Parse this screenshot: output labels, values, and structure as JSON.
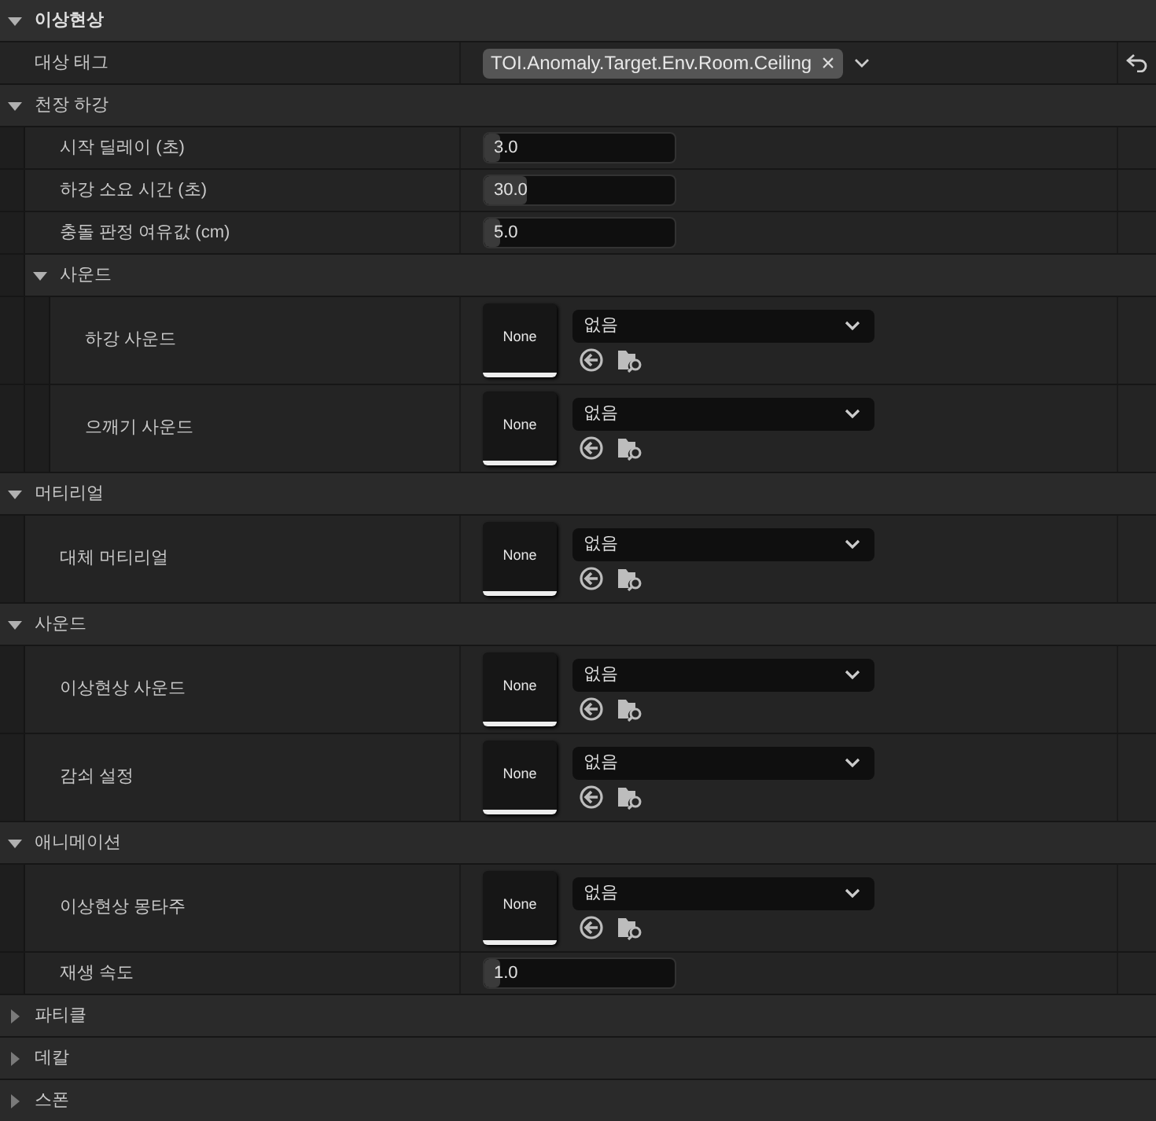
{
  "category": {
    "label": "이상현상",
    "expanded": true,
    "children": [
      {
        "kind": "tag",
        "name": "대상 태그",
        "tag": "TOI.Anomaly.Target.Env.Room.Ceiling",
        "remove_glyph": "×",
        "modified": true
      },
      {
        "kind": "group",
        "label": "천장 하강",
        "expanded": true,
        "children": [
          {
            "kind": "number",
            "name": "시작 딜레이 (초)",
            "value": "3.0",
            "level": 0.08
          },
          {
            "kind": "number",
            "name": "하강 소요 시간 (초)",
            "value": "30.0",
            "level": 0.22
          },
          {
            "kind": "number",
            "name": "충돌 판정 여유값 (cm)",
            "value": "5.0",
            "level": 0.08
          },
          {
            "kind": "group",
            "label": "사운드",
            "expanded": true,
            "children": [
              {
                "kind": "asset",
                "name": "하강 사운드",
                "thumbnail": "None",
                "value": "없음"
              },
              {
                "kind": "asset",
                "name": "으깨기 사운드",
                "thumbnail": "None",
                "value": "없음"
              }
            ]
          }
        ]
      },
      {
        "kind": "group",
        "label": "머티리얼",
        "expanded": true,
        "children": [
          {
            "kind": "asset",
            "name": "대체 머티리얼",
            "thumbnail": "None",
            "value": "없음"
          }
        ]
      },
      {
        "kind": "group",
        "label": "사운드",
        "expanded": true,
        "children": [
          {
            "kind": "asset",
            "name": "이상현상 사운드",
            "thumbnail": "None",
            "value": "없음"
          },
          {
            "kind": "asset",
            "name": "감쇠 설정",
            "thumbnail": "None",
            "value": "없음"
          }
        ]
      },
      {
        "kind": "group",
        "label": "애니메이션",
        "expanded": true,
        "children": [
          {
            "kind": "asset",
            "name": "이상현상 몽타주",
            "thumbnail": "None",
            "value": "없음"
          },
          {
            "kind": "number",
            "name": "재생 속도",
            "value": "1.0",
            "level": 0.06
          }
        ]
      },
      {
        "kind": "group",
        "label": "파티클",
        "expanded": false
      },
      {
        "kind": "group",
        "label": "데칼",
        "expanded": false
      },
      {
        "kind": "group",
        "label": "스폰",
        "expanded": false
      }
    ]
  }
}
